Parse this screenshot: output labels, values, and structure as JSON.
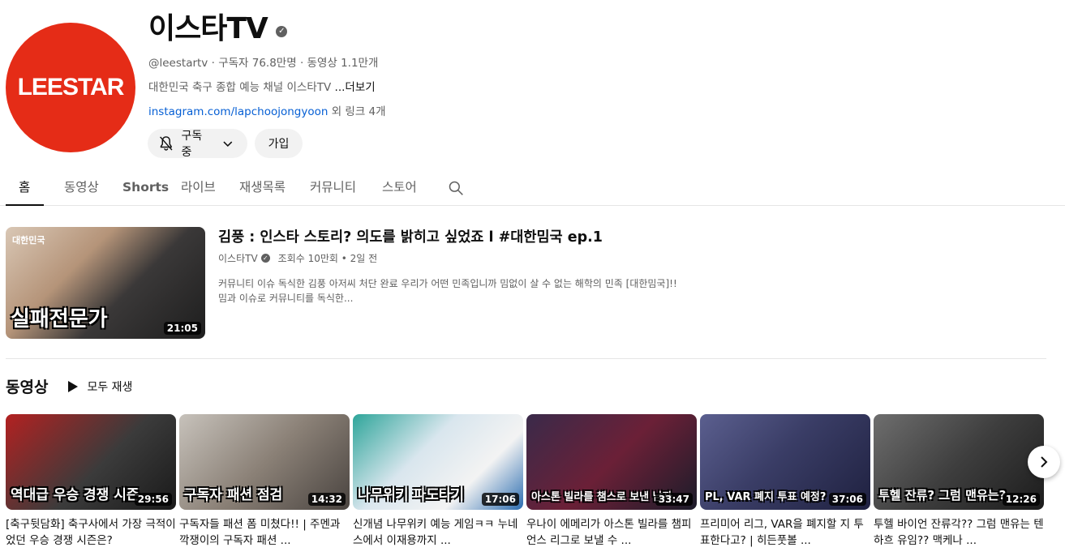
{
  "channel": {
    "avatar_text": "LEESTAR",
    "name": "이스타TV",
    "handle": "@leestartv",
    "subscribers": "구독자 76.8만명",
    "video_count": "동영상 1.1만개",
    "description": "대한민국 축구 종합 예능 채널 이스타TV",
    "more_label": "...더보기",
    "link_text": "instagram.com/lapchoojongyoon",
    "link_extra": " 외 링크 4개",
    "subscribed_label": "구독중",
    "join_label": "가입",
    "brand_color": "#e52c17"
  },
  "tabs": [
    {
      "label": "홈"
    },
    {
      "label": "동영상"
    },
    {
      "label": "Shorts"
    },
    {
      "label": "라이브"
    },
    {
      "label": "재생목록"
    },
    {
      "label": "커뮤니티"
    },
    {
      "label": "스토어"
    }
  ],
  "featured": {
    "thumb_badge": "대한민국",
    "thumb_caption": "실패전문가",
    "duration": "21:05",
    "title": "김풍 : 인스타 스토리? 의도를 밝히고 싶었죠 l #대한밈국 ep.1",
    "channel": "이스타TV",
    "stats": "조회수 10만회 • 2일 전",
    "description_line1": "커뮤니티 이슈 독식한 김풍 아저씨 처단 완료 우리가 어떤 민족입니까 밈없이 살 수 없는 해학의 민족 [대한밈국]!!",
    "description_line2": "밈과 이슈로 커뮤니티를 독식한..."
  },
  "videos_section": {
    "title": "동영상",
    "play_all": "모두 재생"
  },
  "videos": [
    {
      "caption": "역대급 우승 경쟁 시즌",
      "duration": "29:56",
      "title": "[축구뒷담화] 축구사에서 가장 극적이었던 우승 경쟁 시즌은?",
      "bg": "linear-gradient(135deg,#b32121 0%,#3b3b3b 55%,#1a1a1a 100%)"
    },
    {
      "caption": "구독자 패션 점검",
      "duration": "14:32",
      "title": "구독자들 패션 폼 미쳤다!! | 주멘과 깍쟁이의 구독자 패션 ...",
      "bg": "linear-gradient(135deg,#c7c2bb 0%,#8b8177 50%,#4a4440 100%)"
    },
    {
      "caption": "나무위키 파도타기",
      "duration": "17:06",
      "title": "신개념 나무위키 예능 게임ㅋㅋ 누네스에서 이재용까지 ...",
      "bg": "linear-gradient(135deg,#2ea59a 0%,#d9e6ee 40%,#f3f3f3 70%,#2b6cb0 100%)"
    },
    {
      "caption": "아스톤 빌라를 챔스로 보낸 남자",
      "duration": "33:47",
      "title": "우나이 에메리가 아스톤 빌라를 챔피언스 리그로 보낼 수 ...",
      "bg": "linear-gradient(135deg,#3a2a4a 0%,#6b2037 50%,#1c1c2a 100%)"
    },
    {
      "caption": "PL, VAR 폐지 투표 예정?",
      "duration": "37:06",
      "title": "프리미어 리그, VAR을 폐지할 지 투표한다고? | 히든풋볼 ...",
      "bg": "linear-gradient(135deg,#5b5f8f 0%,#3a3d66 45%,#1f2140 100%)"
    },
    {
      "caption": "투헬 잔류? 그럼 맨유는?",
      "duration": "12:26",
      "title": "투헬 바이언 잔류각?? 그럼 맨유는 텐하흐 유임?? 맥케나 ...",
      "bg": "linear-gradient(135deg,#6e6e6e 0%,#3e3e3e 50%,#1c1c1c 100%)"
    }
  ]
}
